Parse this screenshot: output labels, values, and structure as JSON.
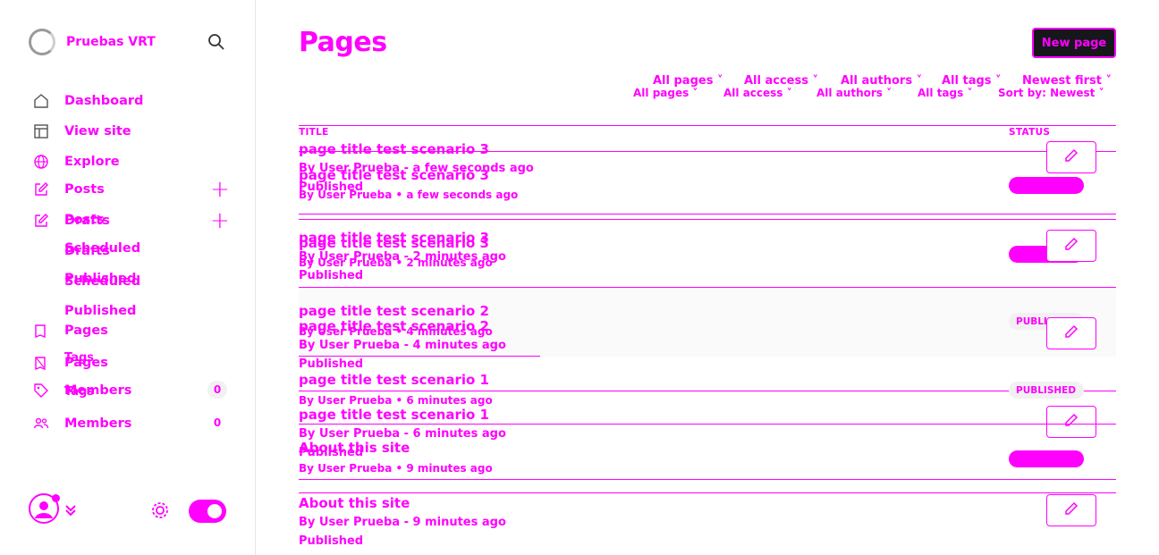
{
  "sidebar": {
    "brand_name": "Pruebas VRT",
    "nav": {
      "dashboard": "Dashboard",
      "view_site": "View site",
      "explore": "Explore",
      "posts": "Posts",
      "drafts_a": "Drafts",
      "drafts_b": "Posts",
      "scheduled_a": "Scheduled",
      "scheduled_b": "Drafts",
      "published_a": "Published",
      "published_b": "Scheduled",
      "published_c": "Published",
      "pages_a": "Pages",
      "pages_b": "Pages",
      "tags_a": "Tags",
      "tags_b": "Pages",
      "members_a": "Members",
      "members_b": "Tags",
      "members_c": "Members",
      "members_count_a": "0",
      "members_count_b": "0"
    }
  },
  "header": {
    "title": "Pages",
    "new_button": "New page"
  },
  "filters": {
    "row1": [
      "All pages",
      "All access",
      "All authors",
      "All tags",
      "Newest first"
    ],
    "row2": [
      "All pages",
      "All access",
      "All authors",
      "All tags",
      "Sort by: Newest"
    ]
  },
  "table": {
    "col_title": "TITLE",
    "col_status": "STATUS",
    "rows": [
      {
        "title": "page title test scenario 3",
        "meta": "By User Prueba - a few seconds ago",
        "status": "Published"
      },
      {
        "title": "page title test scenario 3",
        "meta": "By User Prueba • a few seconds ago",
        "status": ""
      },
      {
        "title": "page title test scenario 3",
        "meta": "By User Prueba - 2 minutes ago",
        "status": "Published"
      },
      {
        "title": "page title test scenario 3",
        "meta": "By User Prueba • 2 minutes ago",
        "status": ""
      },
      {
        "title": "page title test scenario 2",
        "meta": "By User Prueba • 4 minutes ago",
        "status": ""
      },
      {
        "title": "page title test scenario 2",
        "meta": "By User Prueba - 4 minutes ago",
        "status": "Published"
      },
      {
        "title": "page title test scenario 1",
        "meta": "By User Prueba • 6 minutes ago",
        "status": ""
      },
      {
        "title": "page title test scenario 1",
        "meta": "By User Prueba - 6 minutes ago",
        "status": "Published"
      },
      {
        "title": "About this site",
        "meta": "By User Prueba • 9 minutes ago",
        "status": ""
      },
      {
        "title": "About this site",
        "meta": "By User Prueba - 9 minutes ago",
        "status": "Published"
      }
    ],
    "badge_published": "PUBLISHED",
    "badge_published_short": "PUBLISH"
  },
  "colors": {
    "accent": "#ff00ff",
    "button_bg": "#15171a"
  }
}
